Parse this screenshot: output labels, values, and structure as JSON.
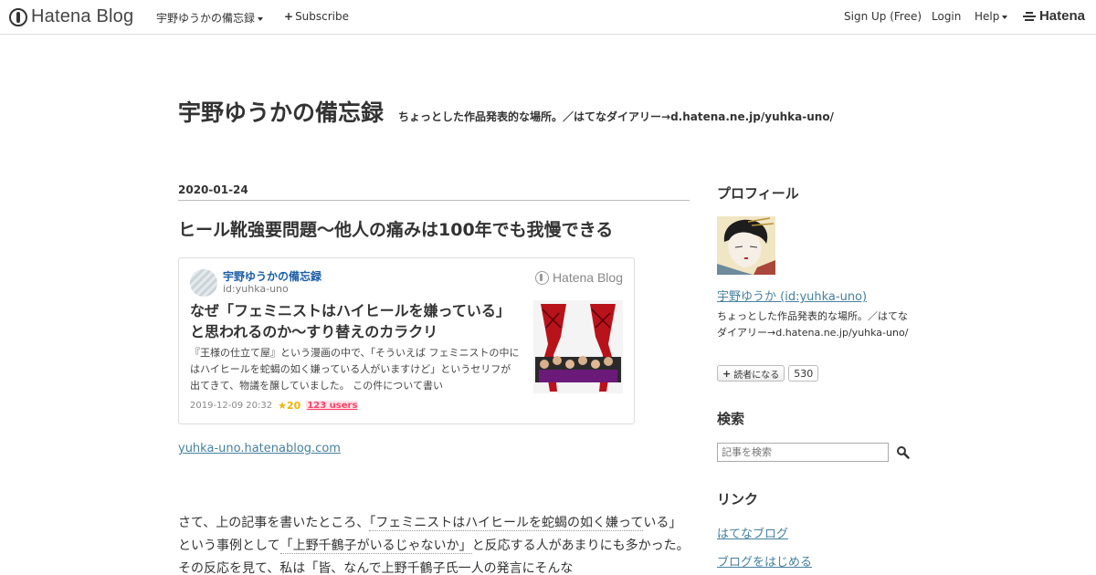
{
  "topbar": {
    "logo_text": "Hatena Blog",
    "blog_menu": "宇野ゆうかの備忘録",
    "subscribe": "Subscribe",
    "signup": "Sign Up (Free)",
    "login": "Login",
    "help": "Help",
    "hatena": "Hatena"
  },
  "blog": {
    "title": "宇野ゆうかの備忘録",
    "description": "ちょっとした作品発表的な場所。／はてなダイアリー→d.hatena.ne.jp/yuhka-uno/"
  },
  "entry": {
    "date": "2020-01-24",
    "title": "ヒール靴強要問題～他人の痛みは100年でも我慢できる",
    "embed": {
      "blog_name": "宇野ゆうかの備忘録",
      "user_id": "id:yuhka-uno",
      "brand": "Hatena Blog",
      "title": "なぜ「フェミニストはハイヒールを嫌っている」と思われるのか～すり替えのカラクリ",
      "excerpt": "『王様の仕立て屋』という漫画の中で、「そういえば フェミニストの中にはハイヒールを蛇蝎の如く嫌っている人がいますけど」というセリフが出てきて、物議を醸していました。 この件について書い",
      "datetime": "2019-12-09 20:32",
      "stars": "20",
      "users": "123 users"
    },
    "embed_link": "yuhka-uno.hatenablog.com",
    "body": {
      "p1": "さて、上の記事を書いたところ、",
      "q1": "「フェミニストはハイヒールを蛇蝎の如く嫌って",
      "p2": "いる」",
      "p3": "という事例として",
      "q2": "「上野千鶴子がいるじゃないか」",
      "p4": "と反応する人があまりにも多かった。その反応を見て、私は「皆、なんで上野千鶴子氏一人の発言にそんな"
    }
  },
  "sidebar": {
    "profile_heading": "プロフィール",
    "username": "宇野ゆうか (id:yuhka-uno)",
    "description": "ちょっとした作品発表的な場所。／はてなダイアリー→d.hatena.ne.jp/yuhka-uno/",
    "subscribe_label": "読者になる",
    "subscriber_count": "530",
    "search_heading": "検索",
    "search_placeholder": "記事を検索",
    "links_heading": "リンク",
    "links": [
      "はてなブログ",
      "ブログをはじめる"
    ]
  },
  "colors": {
    "link": "#47809e",
    "embed_blog_name": "#1a5da8",
    "star": "#f0b400",
    "users": "#ff4166"
  }
}
